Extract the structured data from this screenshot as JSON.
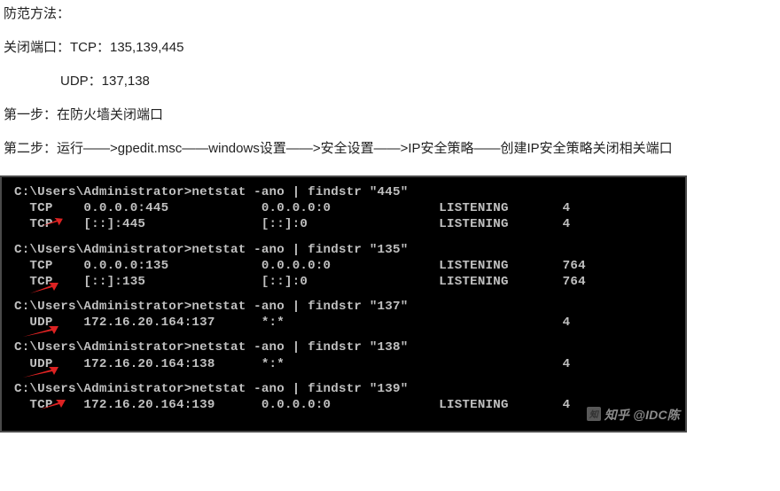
{
  "article": {
    "p1": "防范方法：",
    "p2": "关闭端口：TCP：135,139,445",
    "p3": "UDP：137,138",
    "p4": "第一步：在防火墙关闭端口",
    "p5": "第二步：运行——>gpedit.msc——windows设置——>安全设置——>IP安全策略——创建IP安全策略关闭相关端口"
  },
  "terminal": {
    "blocks": [
      {
        "id": "blk-445",
        "lines": [
          "C:\\Users\\Administrator>netstat -ano | findstr \"445\"",
          "  TCP    0.0.0.0:445            0.0.0.0:0              LISTENING       4",
          "  TCP    [::]:445               [::]:0                 LISTENING       4"
        ],
        "arrow": "a"
      },
      {
        "id": "blk-135",
        "lines": [
          "C:\\Users\\Administrator>netstat -ano | findstr \"135\"",
          "  TCP    0.0.0.0:135            0.0.0.0:0              LISTENING       764",
          "  TCP    [::]:135               [::]:0                 LISTENING       764"
        ],
        "arrow": "b"
      },
      {
        "id": "blk-137",
        "lines": [
          "C:\\Users\\Administrator>netstat -ano | findstr \"137\"",
          "  UDP    172.16.20.164:137      *:*                                    4"
        ],
        "arrow": "c"
      },
      {
        "id": "blk-138",
        "lines": [
          "C:\\Users\\Administrator>netstat -ano | findstr \"138\"",
          "  UDP    172.16.20.164:138      *:*                                    4"
        ],
        "arrow": "d"
      },
      {
        "id": "blk-139",
        "lines": [
          "C:\\Users\\Administrator>netstat -ano | findstr \"139\"",
          "  TCP    172.16.20.164:139      0.0.0.0:0              LISTENING       4"
        ],
        "arrow": "e"
      }
    ]
  },
  "watermark": {
    "text": "知乎 @IDC陈"
  }
}
